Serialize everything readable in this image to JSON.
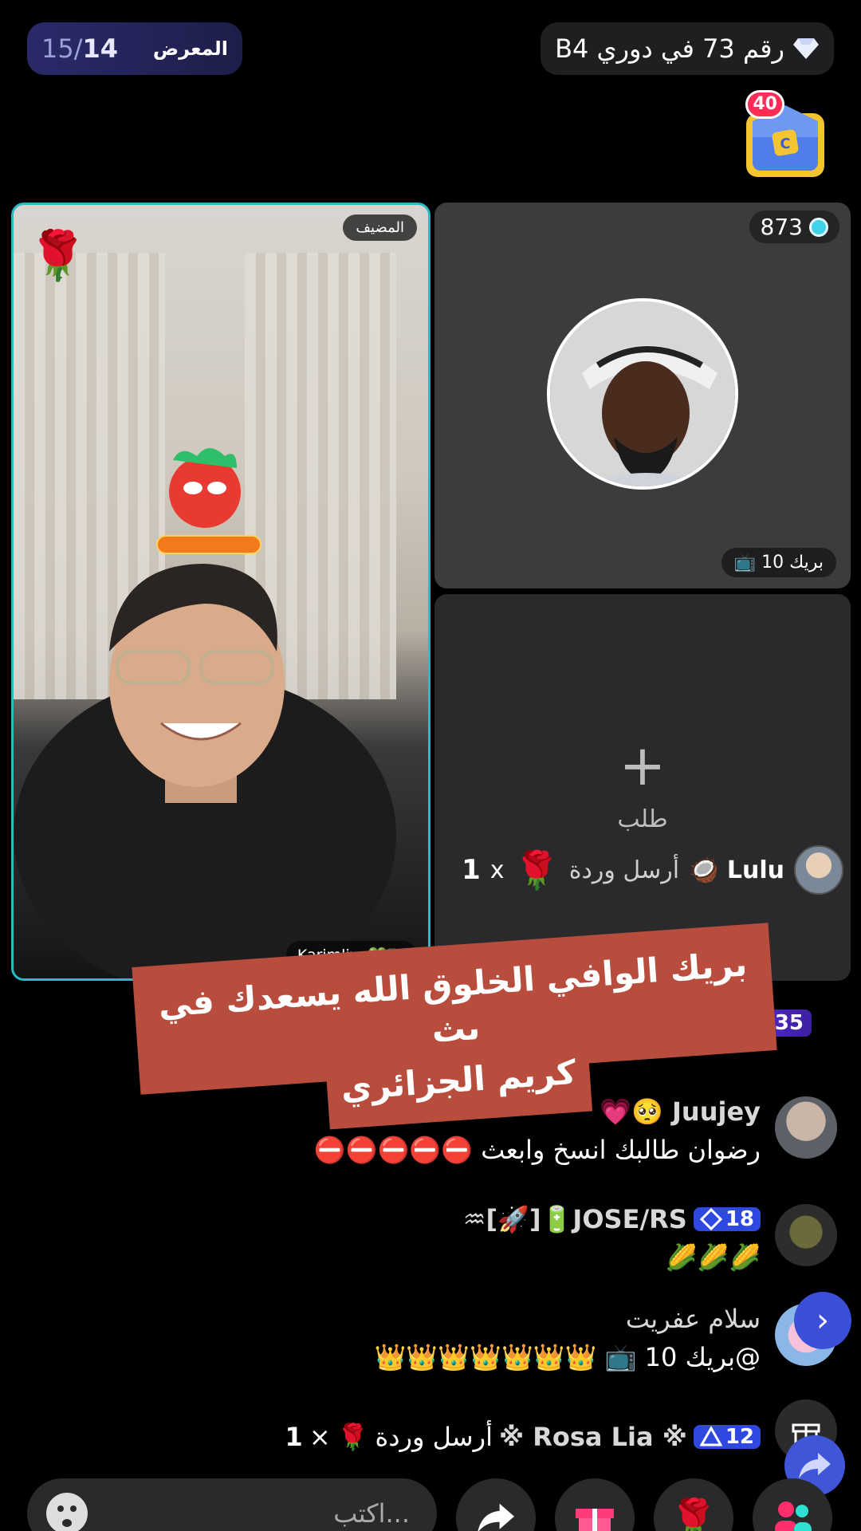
{
  "header": {
    "rank_text": "رقم 73 في دوري B4",
    "gallery_label": "المعرض",
    "gallery_current": "14",
    "gallery_total": "15",
    "chest_badge": "40"
  },
  "host": {
    "badge": "المضيف",
    "name": "Karimlive💚🇩🇿"
  },
  "guest": {
    "score": "873",
    "break_label": "بريك 10 📺"
  },
  "request": {
    "plus": "+",
    "label": "طلب"
  },
  "gift_lulu": {
    "name": "Lulu 🥥",
    "verb": "أرسل وردة",
    "gift": "🌹",
    "times": "x",
    "count": "1"
  },
  "banner": {
    "line1": "بريك الوافي الخلوق الله يسعدك في بث",
    "line2": "كريم الجزائري"
  },
  "partial_chip": "35",
  "chat": [
    {
      "name": "Juujey 🥺💗",
      "message": "رضوان طالبك انسخ وابعث ⛔⛔⛔⛔⛔"
    },
    {
      "level": "18",
      "name": "JOSE/RS🔋[🚀]♒",
      "message": "🌽🌽🌽"
    },
    {
      "name": "سلام عفريت",
      "message": "@بريك 10 📺 👑👑👑👑👑👑👑"
    }
  ],
  "rosa": {
    "level": "12",
    "name": "※ Rosa Lia ※",
    "verb": "أرسل وردة",
    "gift": "🌹",
    "times": "×",
    "count": "1"
  },
  "composer": {
    "placeholder": "اكتب..."
  },
  "colors": {
    "accent_blue": "#2f48e0",
    "host_border": "#2bb9c3",
    "banner_red": "#b84d3e"
  }
}
